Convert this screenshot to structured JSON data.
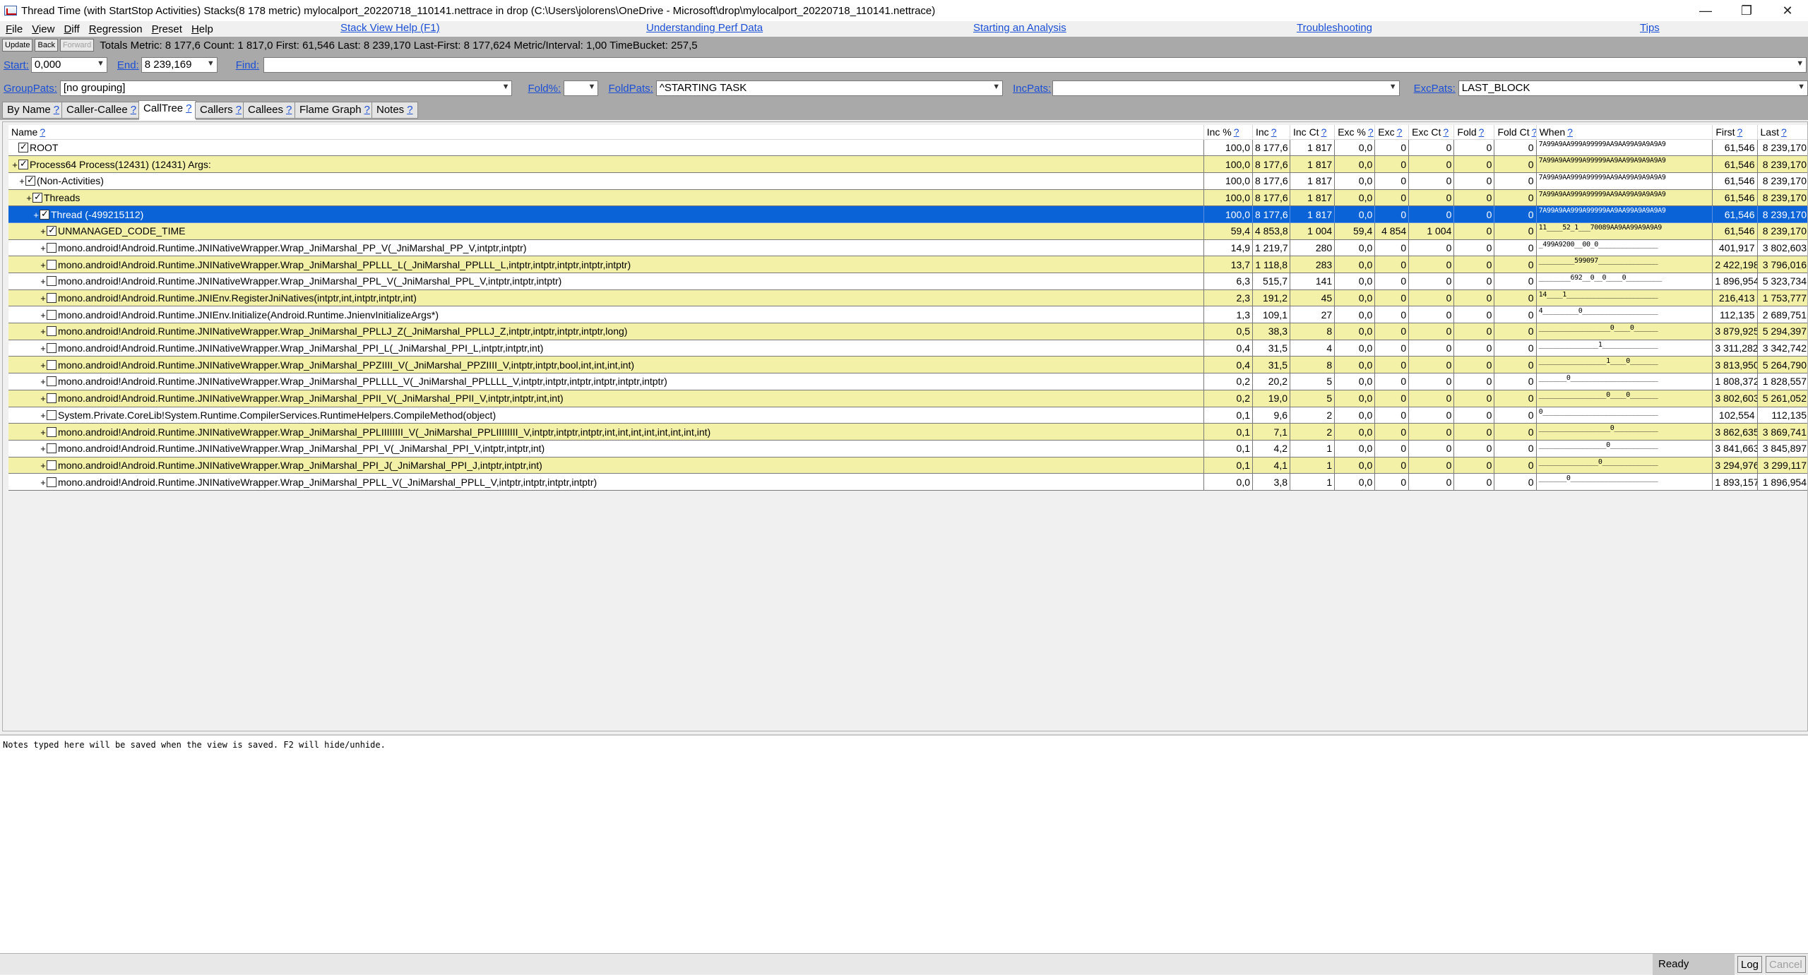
{
  "window": {
    "title": "Thread Time (with StartStop Activities) Stacks(8 178 metric) mylocalport_20220718_110141.nettrace in drop (C:\\Users\\jolorens\\OneDrive - Microsoft\\drop\\mylocalport_20220718_110141.nettrace)",
    "controls": [
      "—",
      "❐",
      "✕"
    ]
  },
  "menu": {
    "items": [
      "File",
      "View",
      "Diff",
      "Regression",
      "Preset",
      "Help"
    ],
    "links": [
      "Stack View Help (F1)",
      "Understanding Perf Data",
      "Starting an Analysis",
      "Troubleshooting",
      "Tips"
    ]
  },
  "toolbar": {
    "update": "Update",
    "back": "Back",
    "forward": "Forward",
    "totals": "Totals Metric: 8 177,6  Count: 1 817,0  First: 61,546 Last: 8 239,170  Last-First: 8 177,624  Metric/Interval: 1,00  TimeBucket: 257,5"
  },
  "filters": {
    "start_label": "Start:",
    "start_value": "0,000",
    "end_label": "End:",
    "end_value": "8 239,169",
    "find_label": "Find:",
    "find_value": "",
    "grouppats_label": "GroupPats:",
    "grouppats_value": "[no grouping]",
    "fold_label": "Fold%:",
    "fold_value": "",
    "foldpats_label": "FoldPats:",
    "foldpats_value": "^STARTING TASK",
    "incpats_label": "IncPats:",
    "incpats_value": "",
    "excpats_label": "ExcPats:",
    "excpats_value": "LAST_BLOCK"
  },
  "tabs": [
    {
      "label": "By Name"
    },
    {
      "label": "Caller-Callee"
    },
    {
      "label": "CallTree"
    },
    {
      "label": "Callers"
    },
    {
      "label": "Callees"
    },
    {
      "label": "Flame Graph"
    },
    {
      "label": "Notes"
    }
  ],
  "tab_help": "?",
  "columns": [
    "Name",
    "Inc %",
    "Inc",
    "Inc Ct",
    "Exc %",
    "Exc",
    "Exc Ct",
    "Fold",
    "Fold Ct",
    "When",
    "First",
    "Last"
  ],
  "rows": [
    {
      "indent": 0,
      "expander": "",
      "checked": true,
      "name": "ROOT",
      "inc_pct": "100,0",
      "inc": "8 177,6",
      "inc_ct": "1 817",
      "exc_pct": "0,0",
      "exc": "0",
      "exc_ct": "0",
      "fold": "0",
      "fold_ct": "0",
      "when": "7A99A9AA999A99999AA9AA99A9A9A9A9",
      "first": "61,546",
      "last": "8 239,170",
      "style": "w"
    },
    {
      "indent": 0,
      "expander": "+",
      "checked": true,
      "name": "Process64 Process(12431) (12431) Args:",
      "inc_pct": "100,0",
      "inc": "8 177,6",
      "inc_ct": "1 817",
      "exc_pct": "0,0",
      "exc": "0",
      "exc_ct": "0",
      "fold": "0",
      "fold_ct": "0",
      "when": "7A99A9AA999A99999AA9AA99A9A9A9A9",
      "first": "61,546",
      "last": "8 239,170",
      "style": "y"
    },
    {
      "indent": 1,
      "expander": "+",
      "checked": true,
      "name": "(Non-Activities)",
      "inc_pct": "100,0",
      "inc": "8 177,6",
      "inc_ct": "1 817",
      "exc_pct": "0,0",
      "exc": "0",
      "exc_ct": "0",
      "fold": "0",
      "fold_ct": "0",
      "when": "7A99A9AA999A99999AA9AA99A9A9A9A9",
      "first": "61,546",
      "last": "8 239,170",
      "style": "w"
    },
    {
      "indent": 2,
      "expander": "+",
      "checked": true,
      "name": "Threads",
      "inc_pct": "100,0",
      "inc": "8 177,6",
      "inc_ct": "1 817",
      "exc_pct": "0,0",
      "exc": "0",
      "exc_ct": "0",
      "fold": "0",
      "fold_ct": "0",
      "when": "7A99A9AA999A99999AA9AA99A9A9A9A9",
      "first": "61,546",
      "last": "8 239,170",
      "style": "y"
    },
    {
      "indent": 3,
      "expander": "+",
      "checked": true,
      "name": "Thread (-499215112)",
      "inc_pct": "100,0",
      "inc": "8 177,6",
      "inc_ct": "1 817",
      "exc_pct": "0,0",
      "exc": "0",
      "exc_ct": "0",
      "fold": "0",
      "fold_ct": "0",
      "when": "7A99A9AA999A99999AA9AA99A9A9A9A9",
      "first": "61,546",
      "last": "8 239,170",
      "style": "sel"
    },
    {
      "indent": 4,
      "expander": "+",
      "checked": true,
      "name": "UNMANAGED_CODE_TIME",
      "inc_pct": "59,4",
      "inc": "4 853,8",
      "inc_ct": "1 004",
      "exc_pct": "59,4",
      "exc": "4 854",
      "exc_ct": "1 004",
      "fold": "0",
      "fold_ct": "0",
      "when": "11____52_1___70089AA9AA99A9A9A9",
      "first": "61,546",
      "last": "8 239,170",
      "style": "y"
    },
    {
      "indent": 4,
      "expander": "+",
      "checked": false,
      "name": "mono.android!Android.Runtime.JNINativeWrapper.Wrap_JniMarshal_PP_V(_JniMarshal_PP_V,intptr,intptr)",
      "inc_pct": "14,9",
      "inc": "1 219,7",
      "inc_ct": "280",
      "exc_pct": "0,0",
      "exc": "0",
      "exc_ct": "0",
      "fold": "0",
      "fold_ct": "0",
      "when": "_499A9200__00_0_______________",
      "first": "401,917",
      "last": "3 802,603",
      "style": "w"
    },
    {
      "indent": 4,
      "expander": "+",
      "checked": false,
      "name": "mono.android!Android.Runtime.JNINativeWrapper.Wrap_JniMarshal_PPLLL_L(_JniMarshal_PPLLL_L,intptr,intptr,intptr,intptr,intptr)",
      "inc_pct": "13,7",
      "inc": "1 118,8",
      "inc_ct": "283",
      "exc_pct": "0,0",
      "exc": "0",
      "exc_ct": "0",
      "fold": "0",
      "fold_ct": "0",
      "when": "_________599097_______________",
      "first": "2 422,198",
      "last": "3 796,016",
      "style": "y"
    },
    {
      "indent": 4,
      "expander": "+",
      "checked": false,
      "name": "mono.android!Android.Runtime.JNINativeWrapper.Wrap_JniMarshal_PPL_V(_JniMarshal_PPL_V,intptr,intptr,intptr)",
      "inc_pct": "6,3",
      "inc": "515,7",
      "inc_ct": "141",
      "exc_pct": "0,0",
      "exc": "0",
      "exc_ct": "0",
      "fold": "0",
      "fold_ct": "0",
      "when": "________692__0__0____0_________",
      "first": "1 896,954",
      "last": "5 323,734",
      "style": "w"
    },
    {
      "indent": 4,
      "expander": "+",
      "checked": false,
      "name": "mono.android!Android.Runtime.JNIEnv.RegisterJniNatives(intptr,int,intptr,intptr,int)",
      "inc_pct": "2,3",
      "inc": "191,2",
      "inc_ct": "45",
      "exc_pct": "0,0",
      "exc": "0",
      "exc_ct": "0",
      "fold": "0",
      "fold_ct": "0",
      "when": "14____1_______________________",
      "first": "216,413",
      "last": "1 753,777",
      "style": "y"
    },
    {
      "indent": 4,
      "expander": "+",
      "checked": false,
      "name": "mono.android!Android.Runtime.JNIEnv.Initialize(Android.Runtime.JnienvInitializeArgs*)",
      "inc_pct": "1,3",
      "inc": "109,1",
      "inc_ct": "27",
      "exc_pct": "0,0",
      "exc": "0",
      "exc_ct": "0",
      "fold": "0",
      "fold_ct": "0",
      "when": "4_________0___________________",
      "first": "112,135",
      "last": "2 689,751",
      "style": "w"
    },
    {
      "indent": 4,
      "expander": "+",
      "checked": false,
      "name": "mono.android!Android.Runtime.JNINativeWrapper.Wrap_JniMarshal_PPLLJ_Z(_JniMarshal_PPLLJ_Z,intptr,intptr,intptr,intptr,long)",
      "inc_pct": "0,5",
      "inc": "38,3",
      "inc_ct": "8",
      "exc_pct": "0,0",
      "exc": "0",
      "exc_ct": "0",
      "fold": "0",
      "fold_ct": "0",
      "when": "__________________0____0______",
      "first": "3 879,925",
      "last": "5 294,397",
      "style": "y"
    },
    {
      "indent": 4,
      "expander": "+",
      "checked": false,
      "name": "mono.android!Android.Runtime.JNINativeWrapper.Wrap_JniMarshal_PPI_L(_JniMarshal_PPI_L,intptr,intptr,int)",
      "inc_pct": "0,4",
      "inc": "31,5",
      "inc_ct": "4",
      "exc_pct": "0,0",
      "exc": "0",
      "exc_ct": "0",
      "fold": "0",
      "fold_ct": "0",
      "when": "_______________1______________",
      "first": "3 311,282",
      "last": "3 342,742",
      "style": "w"
    },
    {
      "indent": 4,
      "expander": "+",
      "checked": false,
      "name": "mono.android!Android.Runtime.JNINativeWrapper.Wrap_JniMarshal_PPZIIII_V(_JniMarshal_PPZIIII_V,intptr,intptr,bool,int,int,int,int)",
      "inc_pct": "0,4",
      "inc": "31,5",
      "inc_ct": "8",
      "exc_pct": "0,0",
      "exc": "0",
      "exc_ct": "0",
      "fold": "0",
      "fold_ct": "0",
      "when": "_________________1____0_______",
      "first": "3 813,950",
      "last": "5 264,790",
      "style": "y"
    },
    {
      "indent": 4,
      "expander": "+",
      "checked": false,
      "name": "mono.android!Android.Runtime.JNINativeWrapper.Wrap_JniMarshal_PPLLLL_V(_JniMarshal_PPLLLL_V,intptr,intptr,intptr,intptr,intptr,intptr)",
      "inc_pct": "0,2",
      "inc": "20,2",
      "inc_ct": "5",
      "exc_pct": "0,0",
      "exc": "0",
      "exc_ct": "0",
      "fold": "0",
      "fold_ct": "0",
      "when": "_______0______________________",
      "first": "1 808,372",
      "last": "1 828,557",
      "style": "w"
    },
    {
      "indent": 4,
      "expander": "+",
      "checked": false,
      "name": "mono.android!Android.Runtime.JNINativeWrapper.Wrap_JniMarshal_PPII_V(_JniMarshal_PPII_V,intptr,intptr,int,int)",
      "inc_pct": "0,2",
      "inc": "19,0",
      "inc_ct": "5",
      "exc_pct": "0,0",
      "exc": "0",
      "exc_ct": "0",
      "fold": "0",
      "fold_ct": "0",
      "when": "_________________0____0_______",
      "first": "3 802,603",
      "last": "5 261,052",
      "style": "y"
    },
    {
      "indent": 4,
      "expander": "+",
      "checked": false,
      "name": "System.Private.CoreLib!System.Runtime.CompilerServices.RuntimeHelpers.CompileMethod(object)",
      "inc_pct": "0,1",
      "inc": "9,6",
      "inc_ct": "2",
      "exc_pct": "0,0",
      "exc": "0",
      "exc_ct": "0",
      "fold": "0",
      "fold_ct": "0",
      "when": "0_____________________________",
      "first": "102,554",
      "last": "112,135",
      "style": "w"
    },
    {
      "indent": 4,
      "expander": "+",
      "checked": false,
      "name": "mono.android!Android.Runtime.JNINativeWrapper.Wrap_JniMarshal_PPLIIIIIIII_V(_JniMarshal_PPLIIIIIIII_V,intptr,intptr,intptr,int,int,int,int,int,int,int,int)",
      "inc_pct": "0,1",
      "inc": "7,1",
      "inc_ct": "2",
      "exc_pct": "0,0",
      "exc": "0",
      "exc_ct": "0",
      "fold": "0",
      "fold_ct": "0",
      "when": "__________________0___________",
      "first": "3 862,635",
      "last": "3 869,741",
      "style": "y"
    },
    {
      "indent": 4,
      "expander": "+",
      "checked": false,
      "name": "mono.android!Android.Runtime.JNINativeWrapper.Wrap_JniMarshal_PPI_V(_JniMarshal_PPI_V,intptr,intptr,int)",
      "inc_pct": "0,1",
      "inc": "4,2",
      "inc_ct": "1",
      "exc_pct": "0,0",
      "exc": "0",
      "exc_ct": "0",
      "fold": "0",
      "fold_ct": "0",
      "when": "_________________0____________",
      "first": "3 841,663",
      "last": "3 845,897",
      "style": "w"
    },
    {
      "indent": 4,
      "expander": "+",
      "checked": false,
      "name": "mono.android!Android.Runtime.JNINativeWrapper.Wrap_JniMarshal_PPI_J(_JniMarshal_PPI_J,intptr,intptr,int)",
      "inc_pct": "0,1",
      "inc": "4,1",
      "inc_ct": "1",
      "exc_pct": "0,0",
      "exc": "0",
      "exc_ct": "0",
      "fold": "0",
      "fold_ct": "0",
      "when": "_______________0______________",
      "first": "3 294,976",
      "last": "3 299,117",
      "style": "y"
    },
    {
      "indent": 4,
      "expander": "+",
      "checked": false,
      "name": "mono.android!Android.Runtime.JNINativeWrapper.Wrap_JniMarshal_PPLL_V(_JniMarshal_PPLL_V,intptr,intptr,intptr,intptr)",
      "inc_pct": "0,0",
      "inc": "3,8",
      "inc_ct": "1",
      "exc_pct": "0,0",
      "exc": "0",
      "exc_ct": "0",
      "fold": "0",
      "fold_ct": "0",
      "when": "_______0______________________",
      "first": "1 893,157",
      "last": "1 896,954",
      "style": "w"
    }
  ],
  "notes": {
    "text": "Notes typed here will be saved when the view is saved. F2 will hide/unhide."
  },
  "status": {
    "ready": "Ready",
    "log": "Log",
    "cancel": "Cancel"
  },
  "colors": {
    "selection": "#0a64d8",
    "highlight_row": "#f3f0a8",
    "link": "#1a4fd6",
    "panel_gray": "#a9a9a9"
  }
}
